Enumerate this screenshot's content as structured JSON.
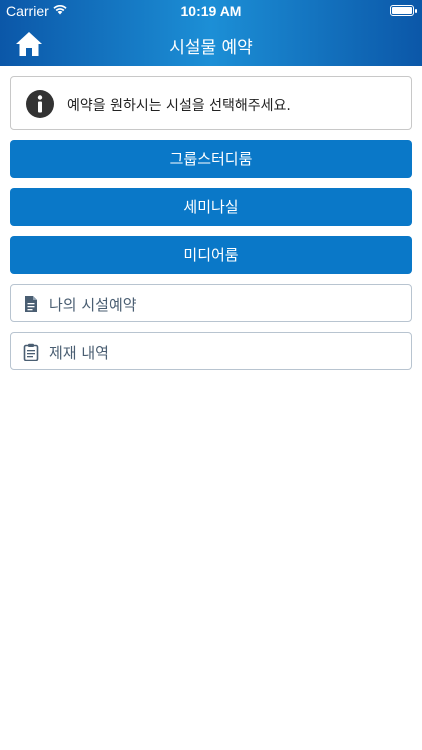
{
  "status_bar": {
    "carrier": "Carrier",
    "time": "10:19 AM"
  },
  "header": {
    "title": "시설물 예약"
  },
  "notice": {
    "text": "예약을 원하시는 시설을 선택해주세요."
  },
  "facilities": [
    {
      "label": "그룹스터디룸"
    },
    {
      "label": "세미나실"
    },
    {
      "label": "미디어룸"
    }
  ],
  "menu": {
    "my_reservations": "나의 시설예약",
    "sanctions": "제재 내역"
  },
  "colors": {
    "primary": "#0a78c8",
    "header": "#1c8fd6",
    "outline_text": "#4a5e72"
  }
}
